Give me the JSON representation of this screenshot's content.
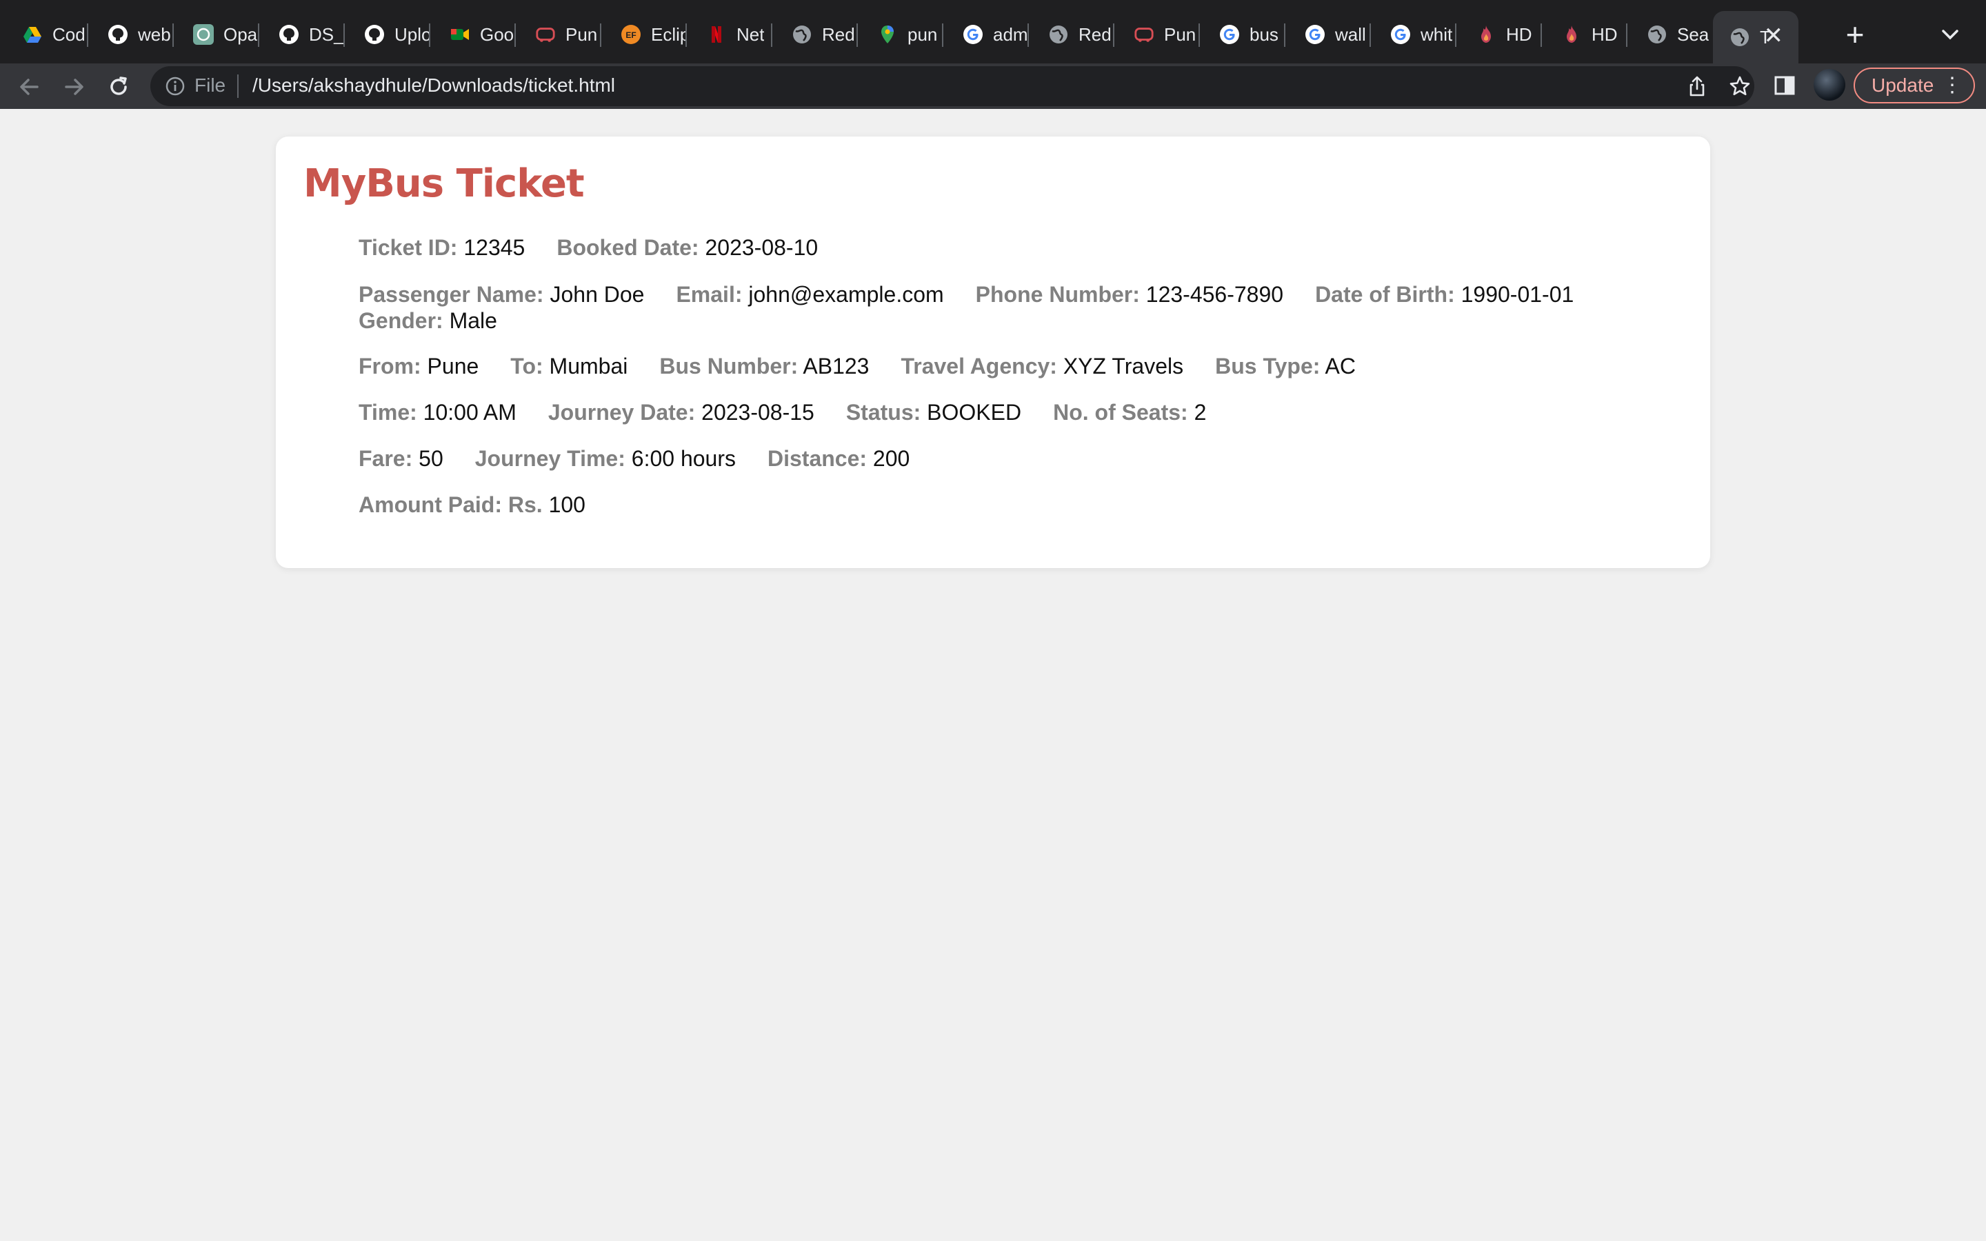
{
  "browser": {
    "tabs": [
      {
        "label": "Cod",
        "icon": "google-drive-icon"
      },
      {
        "label": "web",
        "icon": "github-icon"
      },
      {
        "label": "Opa",
        "icon": "openai-icon"
      },
      {
        "label": "DS_",
        "icon": "github-icon"
      },
      {
        "label": "Uplo",
        "icon": "github-icon"
      },
      {
        "label": "Goo",
        "icon": "google-meet-icon"
      },
      {
        "label": "Pun",
        "icon": "redbus-icon"
      },
      {
        "label": "Eclip",
        "icon": "ef-icon"
      },
      {
        "label": "Net",
        "icon": "netflix-icon"
      },
      {
        "label": "Red",
        "icon": "globe-icon"
      },
      {
        "label": "pun",
        "icon": "google-maps-icon"
      },
      {
        "label": "adm",
        "icon": "google-icon"
      },
      {
        "label": "Red",
        "icon": "globe-icon"
      },
      {
        "label": "Pun",
        "icon": "redbus-icon"
      },
      {
        "label": "bus",
        "icon": "google-icon"
      },
      {
        "label": "wall",
        "icon": "google-icon"
      },
      {
        "label": "whit",
        "icon": "google-icon"
      },
      {
        "label": "HD",
        "icon": "fire-icon"
      },
      {
        "label": "HD",
        "icon": "fire-icon"
      },
      {
        "label": "Sea",
        "icon": "globe-icon"
      },
      {
        "label": "T",
        "icon": "globe-icon",
        "active": true
      }
    ],
    "address": {
      "scheme_label": "File",
      "url": "/Users/akshaydhule/Downloads/ticket.html"
    },
    "update_label": "Update"
  },
  "ticket": {
    "title": "MyBus Ticket",
    "rows": [
      [
        {
          "key": "Ticket ID:",
          "value": "12345"
        },
        {
          "key": "Booked Date:",
          "value": "2023-08-10"
        }
      ],
      [
        {
          "key": "Passenger Name:",
          "value": "John Doe"
        },
        {
          "key": "Email:",
          "value": "john@example.com"
        },
        {
          "key": "Phone Number:",
          "value": "123-456-7890"
        },
        {
          "key": "Date of Birth:",
          "value": "1990-01-01"
        },
        {
          "key": "Gender:",
          "value": "Male"
        }
      ],
      [
        {
          "key": "From:",
          "value": "Pune"
        },
        {
          "key": "To:",
          "value": "Mumbai"
        },
        {
          "key": "Bus Number:",
          "value": "AB123"
        },
        {
          "key": "Travel Agency:",
          "value": "XYZ Travels"
        },
        {
          "key": "Bus Type:",
          "value": "AC"
        }
      ],
      [
        {
          "key": "Time:",
          "value": "10:00 AM"
        },
        {
          "key": "Journey Date:",
          "value": "2023-08-15"
        },
        {
          "key": "Status:",
          "value": "BOOKED"
        },
        {
          "key": "No. of Seats:",
          "value": "2"
        }
      ],
      [
        {
          "key": "Fare:",
          "value": "50"
        },
        {
          "key": "Journey Time:",
          "value": "6:00 hours"
        },
        {
          "key": "Distance:",
          "value": "200"
        }
      ],
      [
        {
          "key": "Amount Paid: Rs.",
          "value": "100"
        }
      ]
    ]
  },
  "colors": {
    "title": "#c9564e",
    "field_key": "#808080",
    "page_bg": "#f0f0f0",
    "update_border": "#f28b82"
  }
}
